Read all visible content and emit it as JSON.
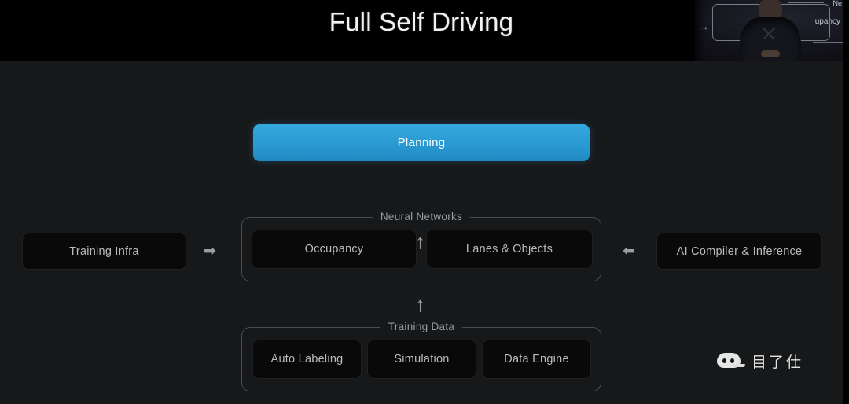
{
  "slide": {
    "title": "Full Self Driving",
    "background_color": "#17181a",
    "band_color": "#000000",
    "accent_color": "#2a9ad2"
  },
  "pip": {
    "label": "presenter-video-overlay",
    "mini_slide_label": "upancy",
    "mini_slide_label_top": "Ne",
    "arrow": "→"
  },
  "diagram": {
    "planning": {
      "label": "Planning"
    },
    "arrows": {
      "planning_up": "↑",
      "neural_up": "↑",
      "left_in": "➡",
      "right_in": "⬅"
    },
    "left_node": {
      "label": "Training Infra"
    },
    "right_node": {
      "label": "AI Compiler & Inference"
    },
    "groups": [
      {
        "legend": "Neural Networks",
        "nodes": [
          {
            "label": "Occupancy"
          },
          {
            "label": "Lanes & Objects"
          }
        ]
      },
      {
        "legend": "Training Data",
        "nodes": [
          {
            "label": "Auto Labeling"
          },
          {
            "label": "Simulation"
          },
          {
            "label": "Data Engine"
          }
        ]
      }
    ]
  },
  "watermark": {
    "text": "目了仕"
  }
}
